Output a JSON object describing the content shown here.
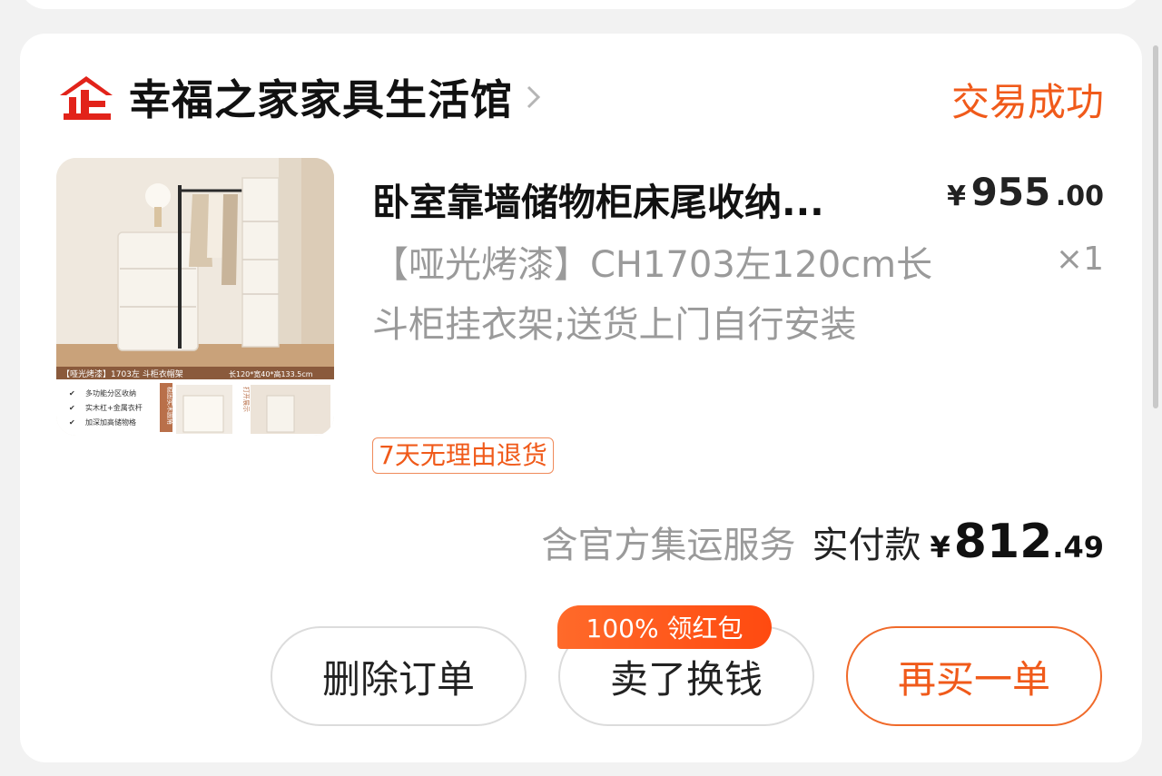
{
  "shop": {
    "logo_text": "企",
    "name": "幸福之家家具生活馆",
    "status": "交易成功"
  },
  "product": {
    "title": "卧室靠墙储物柜床尾收纳...",
    "price_symbol": "¥",
    "price_int": "955",
    "price_dec": ".00",
    "quantity": "×1",
    "spec": "【哑光烤漆】CH1703左120cm长斗柜挂衣架;送货上门自行安装",
    "return_policy": "7天无理由退货",
    "thumb": {
      "banner": "【哑光烤漆】1703左 斗柜衣帽架",
      "dims": "长120*宽40*高133.5cm",
      "features": [
        "多功能分区收纳",
        "实木杠+金属衣杆",
        "加深加高储物格"
      ],
      "tag1": "稳固实木圆角",
      "tag2": "打开展示"
    }
  },
  "payment": {
    "service_note": "含官方集运服务",
    "paid_label": "实付款",
    "symbol": "¥",
    "int": "812",
    "dec": ".49"
  },
  "actions": {
    "delete": "删除订单",
    "sell": "卖了换钱",
    "sell_promo": "100% 领红包",
    "rebuy": "再买一单"
  },
  "colors": {
    "accent": "#f05a1a",
    "logo_red": "#e2231a"
  }
}
